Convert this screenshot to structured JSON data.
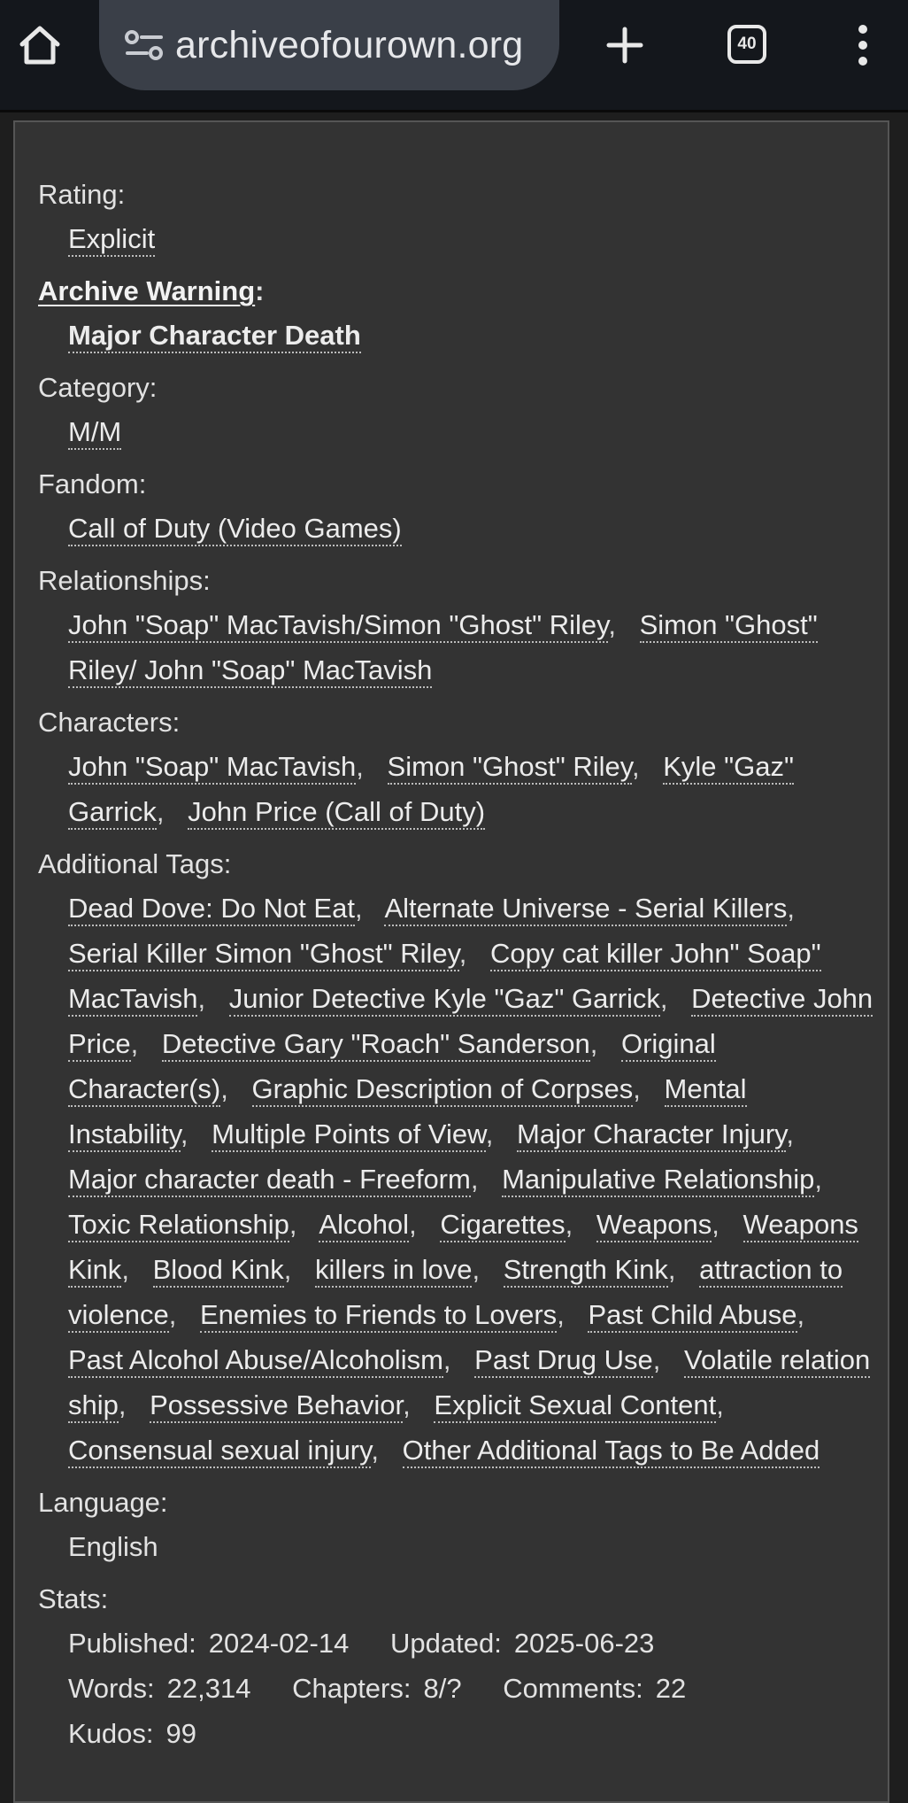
{
  "browser": {
    "url": "archiveofourown.org",
    "tab_count": "40",
    "icons": [
      "home-icon",
      "tune-icon",
      "plus-icon",
      "tab-switcher-icon",
      "more-vert-icon"
    ]
  },
  "work_meta": {
    "rating": {
      "label": "Rating:",
      "tags": [
        "Explicit"
      ]
    },
    "warning": {
      "label": "Archive Warning",
      "colon": ":",
      "tags": [
        "Major Character Death"
      ]
    },
    "category": {
      "label": "Category:",
      "tags": [
        "M/M"
      ]
    },
    "fandom": {
      "label": "Fandom:",
      "tags": [
        "Call of Duty (Video Games)"
      ]
    },
    "relationships": {
      "label": "Relationships:",
      "tags": [
        "John \"Soap\" MacTavish/Simon \"Ghost\" Riley",
        "Simon \"Ghost\" Riley/ John \"Soap\" MacTavish"
      ]
    },
    "characters": {
      "label": "Characters:",
      "tags": [
        "John \"Soap\" MacTavish",
        "Simon \"Ghost\" Riley",
        "Kyle \"Gaz\" Garrick",
        "John Price (Call of Duty)"
      ]
    },
    "additional_tags": {
      "label": "Additional Tags:",
      "tags": [
        "Dead Dove: Do Not Eat",
        "Alternate Universe - Serial Killers",
        "Serial Killer Simon \"Ghost\" Riley",
        "Copy cat killer John\" Soap\" MacTavish",
        "Junior Detective Kyle \"Gaz\" Garrick",
        "Detective John Price",
        "Detective Gary \"Roach\" Sanderson",
        "Original Character(s)",
        "Graphic Description of Corpses",
        "Mental Instability",
        "Multiple Points of View",
        "Major Character Injury",
        "Major character death - Freeform",
        "Manipulative Relationship",
        "Toxic Relationship",
        "Alcohol",
        "Cigarettes",
        "Weapons",
        "Weapons Kink",
        "Blood Kink",
        "killers in love",
        "Strength Kink",
        "attraction to violence",
        "Enemies to Friends to Lovers",
        "Past Child Abuse",
        "Past Alcohol Abuse/Alcoholism",
        "Past Drug Use",
        "Volatile relation ship",
        "Possessive Behavior",
        "Explicit Sexual Content",
        "Consensual sexual injury",
        "Other Additional Tags to Be Added"
      ]
    },
    "language": {
      "label": "Language:",
      "value": "English"
    },
    "stats": {
      "label": "Stats:",
      "published_label": "Published:",
      "published": "2024-02-14",
      "updated_label": "Updated:",
      "updated": "2025-06-23",
      "words_label": "Words:",
      "words": "22,314",
      "chapters_label": "Chapters:",
      "chapters": "8/?",
      "comments_label": "Comments:",
      "comments": "22",
      "kudos_label": "Kudos:",
      "kudos": "99"
    }
  }
}
